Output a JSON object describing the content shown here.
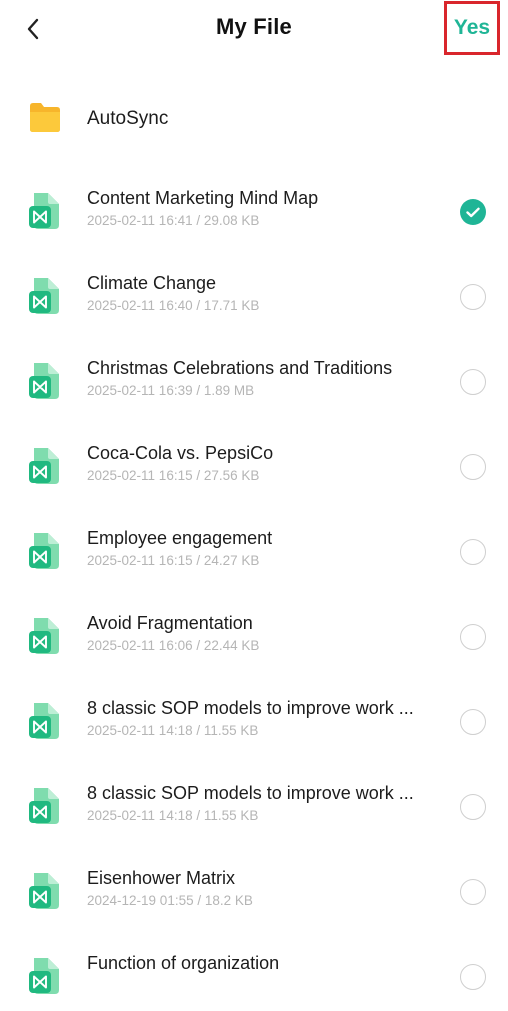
{
  "header": {
    "title": "My File",
    "confirm_label": "Yes"
  },
  "folder": {
    "name": "AutoSync"
  },
  "files": [
    {
      "name": "Content Marketing Mind Map",
      "meta": "2025-02-11 16:41 / 29.08 KB",
      "selected": true
    },
    {
      "name": "Climate Change",
      "meta": "2025-02-11 16:40 / 17.71 KB",
      "selected": false
    },
    {
      "name": "Christmas Celebrations and Traditions",
      "meta": "2025-02-11 16:39 / 1.89 MB",
      "selected": false
    },
    {
      "name": "Coca-Cola vs. PepsiCo",
      "meta": "2025-02-11 16:15 / 27.56 KB",
      "selected": false
    },
    {
      "name": "Employee engagement",
      "meta": "2025-02-11 16:15 / 24.27 KB",
      "selected": false
    },
    {
      "name": "Avoid Fragmentation",
      "meta": "2025-02-11 16:06 / 22.44 KB",
      "selected": false
    },
    {
      "name": "8 classic SOP models to improve work ...",
      "meta": "2025-02-11 14:18 / 11.55 KB",
      "selected": false
    },
    {
      "name": "8 classic SOP models to improve work ...",
      "meta": "2025-02-11 14:18 / 11.55 KB",
      "selected": false
    },
    {
      "name": "Eisenhower Matrix",
      "meta": "2024-12-19 01:55 / 18.2 KB",
      "selected": false
    },
    {
      "name": "Function of organization",
      "meta": "",
      "selected": false
    }
  ],
  "colors": {
    "accent": "#1fb596",
    "highlight_border": "#d9262c",
    "folder": "#fbc02d",
    "file_icon": "#2ec27e"
  },
  "icons": {
    "back": "chevron-left-icon",
    "folder": "folder-icon",
    "file": "mindmap-file-icon",
    "check": "check-icon"
  }
}
